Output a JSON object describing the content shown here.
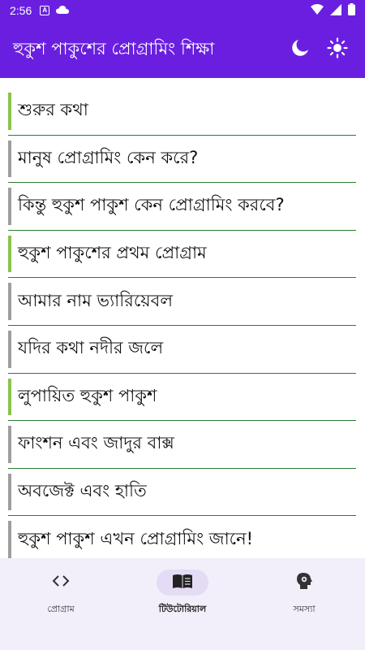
{
  "status_bar": {
    "time": "2:56",
    "icons": [
      "text-a-icon",
      "cloud-icon",
      "wifi-icon",
      "signal-icon",
      "battery-icon"
    ]
  },
  "app_bar": {
    "title": "হুকুশ পাকুশের প্রোগ্রামিং শিক্ষা",
    "actions": [
      "moon-icon",
      "sun-icon"
    ],
    "background": "#6a1fe0"
  },
  "lessons": [
    {
      "label": "শুরুর কথা",
      "highlight": true
    },
    {
      "label": "মানুষ প্রোগ্রামিং কেন করে?",
      "highlight": false
    },
    {
      "label": "কিন্তু হুকুশ পাকুশ কেন প্রোগ্রামিং করবে?",
      "highlight": false
    },
    {
      "label": "হুকুশ পাকুশের প্রথম প্রোগ্রাম",
      "highlight": true
    },
    {
      "label": "আমার নাম ভ্যারিয়েবল",
      "highlight": false
    },
    {
      "label": "যদির কথা নদীর জলে",
      "highlight": false
    },
    {
      "label": "লুপায়িত হুকুশ পাকুশ",
      "highlight": true
    },
    {
      "label": "ফাংশন এবং জাদুর বাক্স",
      "highlight": false
    },
    {
      "label": "অবজেক্ট এবং হাতি",
      "highlight": false
    },
    {
      "label": "হুকুশ পাকুশ এখন প্রোগ্রামিং জানে!",
      "highlight": false
    }
  ],
  "bottom_nav": {
    "items": [
      {
        "label": "প্রোগ্রাম",
        "icon": "code-icon",
        "active": false
      },
      {
        "label": "টিউটোরিয়াল",
        "icon": "book-icon",
        "active": true
      },
      {
        "label": "সমস্যা",
        "icon": "head-gear-icon",
        "active": false
      }
    ]
  }
}
